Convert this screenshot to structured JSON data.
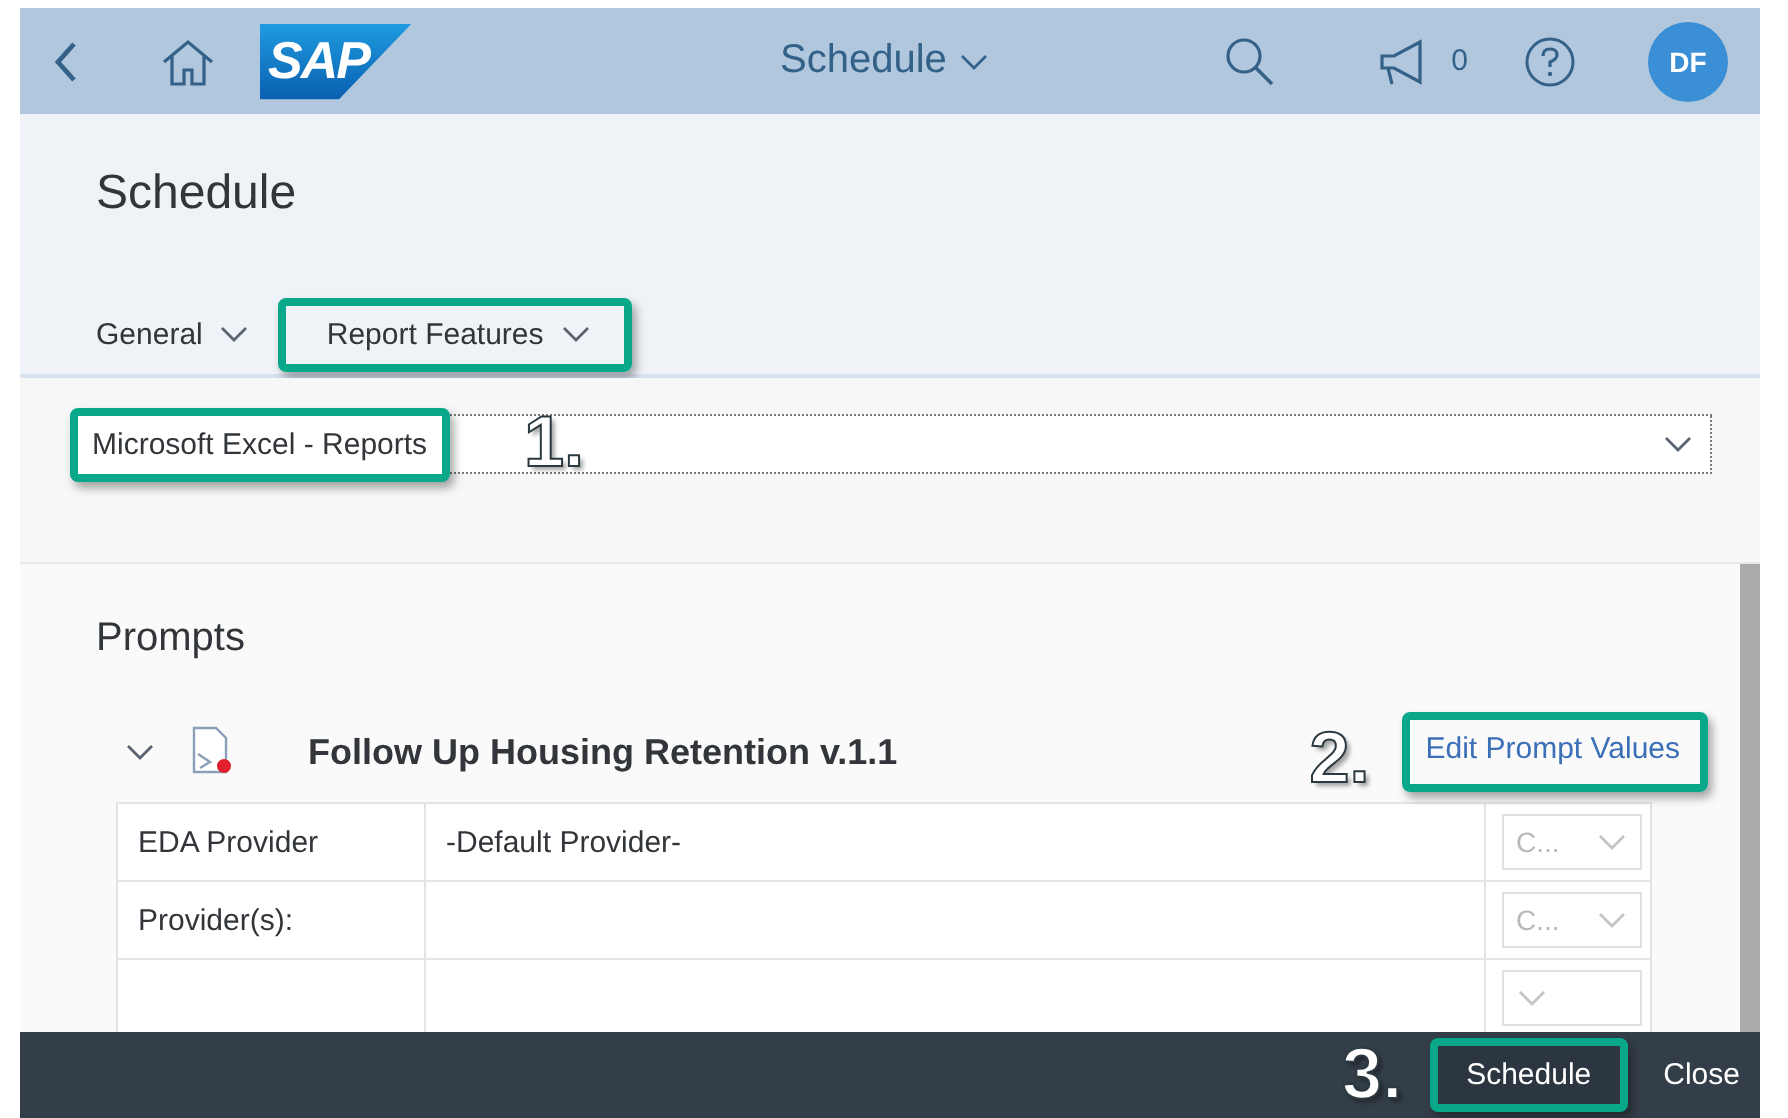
{
  "shell": {
    "logo": "SAP",
    "title": "Schedule",
    "notification_count": "0",
    "avatar_initials": "DF"
  },
  "header": {
    "title": "Schedule",
    "tabs": [
      {
        "label": "General",
        "highlighted": false
      },
      {
        "label": "Report Features",
        "highlighted": true
      }
    ]
  },
  "format_select": {
    "value": "Microsoft Excel - Reports",
    "highlighted": true,
    "step": "1."
  },
  "prompts": {
    "title": "Prompts",
    "report": {
      "title": "Follow Up Housing Retention v.1.1",
      "expanded": true
    },
    "edit_link": {
      "label": "Edit Prompt Values",
      "highlighted": true,
      "step": "2."
    },
    "rows": [
      {
        "label": "EDA Provider",
        "value": "-Default Provider-",
        "control": "C...",
        "disabled": true
      },
      {
        "label": "Provider(s):",
        "control": "C...",
        "disabled": true
      },
      {
        "disabled": true
      }
    ]
  },
  "footer": {
    "buttons": [
      {
        "label": "Schedule",
        "kind": "emphasized",
        "highlighted": true,
        "step": "3."
      },
      {
        "label": "Close",
        "kind": "plain",
        "highlighted": false
      }
    ]
  }
}
